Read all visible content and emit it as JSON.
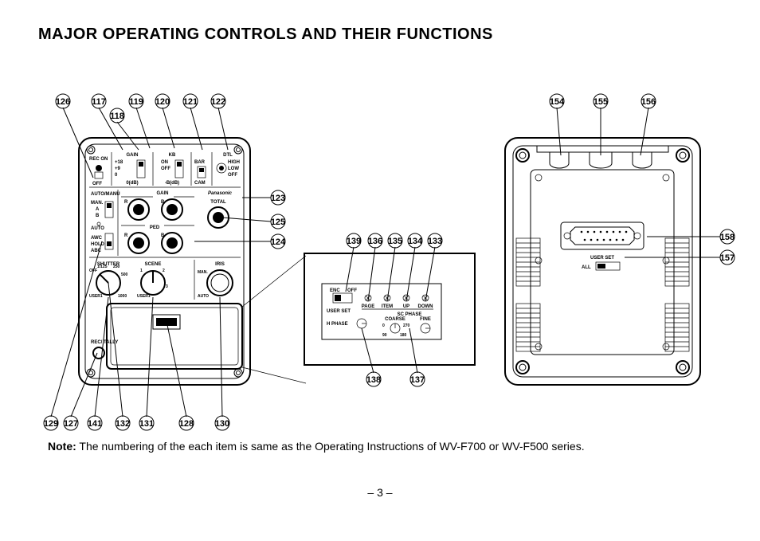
{
  "title": "MAJOR OPERATING CONTROLS AND THEIR FUNCTIONS",
  "note_label": "Note:",
  "note_text": "  The numbering of the each item is same as the Operating Instructions of WV-F700 or WV-F500 series.",
  "page_number": "– 3 –",
  "brand": "Panasonic",
  "front_callouts": {
    "top": [
      "126",
      "117",
      "118",
      "119",
      "120",
      "121",
      "122"
    ],
    "right": [
      "123",
      "125",
      "124"
    ],
    "bottom": [
      "129",
      "127",
      "141",
      "132",
      "131",
      "128",
      "130"
    ]
  },
  "detail_callouts": {
    "top": [
      "139",
      "136",
      "135",
      "134",
      "133"
    ],
    "bottom": [
      "138",
      "137"
    ]
  },
  "rear_callouts": {
    "top": [
      "154",
      "155",
      "156"
    ],
    "right": [
      "158",
      "157"
    ]
  },
  "front_labels": {
    "rec_on": "REC ON",
    "off": "OFF",
    "gain_sec": "GAIN",
    "gain_18": "+18",
    "gain_9": "+9",
    "gain_0": "0",
    "gain_d": "0(dB)",
    "kb_sec": "KB",
    "kb_on": "ON",
    "kb_off": "OFF",
    "kb_neg": "-B(dB)",
    "bar": "BAR",
    "cam": "CAM",
    "dtl": "DTL",
    "dtl_h": "HIGH",
    "dtl_l": "LOW",
    "dtl_o": "OFF",
    "auto_manu": "AUTO/MANU",
    "man": "MAN.",
    "a": "A",
    "b": "B",
    "auto": "AUTO",
    "awc": "AWC",
    "hold": "HOLD",
    "abc": "ABC",
    "gain": "GAIN",
    "gain_r": "R",
    "gain_b": "B",
    "total": "TOTAL",
    "ped": "PED",
    "ped_r": "R",
    "ped_b": "B",
    "shutter": "SHUTTER",
    "sh_off": "OFF",
    "sh_125": "1/125",
    "sh_250": "250",
    "sh_500": "500",
    "sh_1000": "1000",
    "sh_user": "USER1",
    "scene": "SCENE",
    "sc_1": "1",
    "sc_2": "2",
    "sc_3": "3",
    "sc_user": "USER1",
    "iris": "IRIS",
    "iris_man": "MAN.",
    "iris_auto": "AUTO",
    "rec_tally": "REC/\nTALLY"
  },
  "detail_labels": {
    "enc": "ENC",
    "off": "OFF",
    "page": "PAGE",
    "item": "ITEM",
    "up": "UP",
    "down": "DOWN",
    "user_set": "USER SET",
    "sc_phase": "SC PHASE",
    "h_phase": "H PHASE",
    "coarse": "COARSE",
    "fine": "FINE",
    "hp_0": "0",
    "hp_270": "270",
    "hp_90": "90",
    "hp_180": "180"
  },
  "rear_labels": {
    "user_set": "USER SET",
    "all": "ALL"
  }
}
